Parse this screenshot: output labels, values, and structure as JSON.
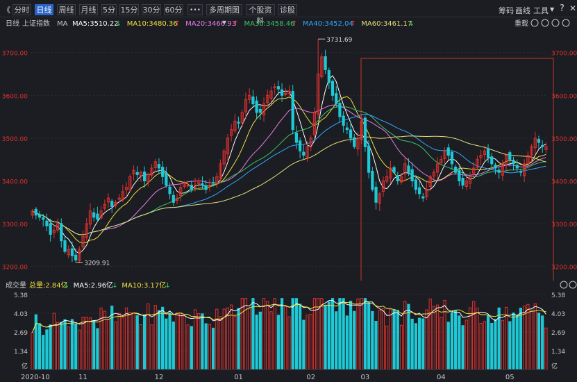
{
  "toolbar": {
    "back_glyph": "《",
    "buttons": [
      "分时",
      "日线",
      "周线",
      "月线",
      "5分",
      "15分",
      "30分",
      "60分",
      "•••",
      "多周期图",
      "个股资料",
      "诊股"
    ],
    "active": "日线",
    "right_items": [
      "筹码",
      "画线",
      "工具"
    ]
  },
  "info_bar": {
    "period": "日线",
    "index_name": "上证指数",
    "ma_label": "MA",
    "ma_items": [
      {
        "label": "MA5:3510.22",
        "color": "#ffffff",
        "arrow": "↓",
        "arrow_color": "#22d35b"
      },
      {
        "label": "MA10:3480.36",
        "color": "#f0e040",
        "arrow": "↑",
        "arrow_color": "#ff3b3b"
      },
      {
        "label": "MA20:3466.93",
        "color": "#e87ce8",
        "arrow": "↑",
        "arrow_color": "#ff3b3b"
      },
      {
        "label": "MA30:3458.46",
        "color": "#3ec46a",
        "arrow": "↑",
        "arrow_color": "#ff3b3b"
      },
      {
        "label": "MA40:3452.04",
        "color": "#33a8ff",
        "arrow": "↑",
        "arrow_color": "#ff3b3b"
      },
      {
        "label": "MA60:3461.17",
        "color": "#e6df7a",
        "arrow": "↓",
        "arrow_color": "#22d35b"
      }
    ],
    "right_label": "重载"
  },
  "volume_bar": {
    "title": "成交量",
    "items": [
      {
        "label": "总量:2.84亿",
        "color": "#f0e040",
        "arrow": "↓",
        "arrow_color": "#22d35b"
      },
      {
        "label": "MA5:2.96亿",
        "color": "#ffffff",
        "arrow": "↓",
        "arrow_color": "#22d35b"
      },
      {
        "label": "MA10:3.17亿",
        "color": "#f0e040",
        "arrow": "↓",
        "arrow_color": "#22d35b"
      }
    ]
  },
  "colors": {
    "up": "#e0312e",
    "down": "#1fc9d6",
    "axis_red": "#e0312e",
    "grid": "#2c2f36"
  },
  "chart_data": {
    "type": "candlestick",
    "price_axis": {
      "ticks": [
        "3200.00",
        "3300.00",
        "3400.00",
        "3500.00",
        "3600.00",
        "3700.00"
      ],
      "range": [
        3180,
        3745
      ]
    },
    "volume_axis": {
      "ticks": [
        "1.34",
        "2.69",
        "4.03",
        "5.38"
      ],
      "range": [
        0,
        5.38
      ],
      "unit": "亿"
    },
    "x_labels": [
      "2020-10",
      "11",
      "12",
      "01",
      "02",
      "03",
      "04",
      "05"
    ],
    "x_label_positions": [
      2,
      14,
      35,
      57,
      77,
      92,
      113,
      132
    ],
    "annotations": [
      {
        "text": "3731.69",
        "index": 79
      },
      {
        "text": "3209.91",
        "index": 12
      }
    ],
    "close": [
      3330,
      3320,
      3315,
      3310,
      3295,
      3275,
      3285,
      3300,
      3260,
      3235,
      3240,
      3225,
      3215,
      3240,
      3270,
      3300,
      3330,
      3315,
      3310,
      3330,
      3345,
      3360,
      3340,
      3350,
      3360,
      3375,
      3385,
      3410,
      3425,
      3415,
      3420,
      3400,
      3415,
      3430,
      3445,
      3430,
      3410,
      3390,
      3370,
      3350,
      3360,
      3385,
      3395,
      3390,
      3380,
      3390,
      3400,
      3390,
      3380,
      3390,
      3395,
      3410,
      3440,
      3470,
      3500,
      3520,
      3540,
      3535,
      3560,
      3590,
      3600,
      3580,
      3560,
      3560,
      3580,
      3600,
      3610,
      3620,
      3615,
      3600,
      3605,
      3610,
      3520,
      3490,
      3470,
      3460,
      3480,
      3500,
      3560,
      3650,
      3690,
      3660,
      3630,
      3600,
      3580,
      3550,
      3530,
      3520,
      3500,
      3480,
      3500,
      3540,
      3480,
      3420,
      3380,
      3350,
      3370,
      3400,
      3410,
      3430,
      3420,
      3400,
      3410,
      3440,
      3420,
      3400,
      3380,
      3370,
      3360,
      3380,
      3410,
      3420,
      3440,
      3450,
      3470,
      3460,
      3440,
      3420,
      3400,
      3390,
      3400,
      3410,
      3430,
      3450,
      3460,
      3470,
      3455,
      3440,
      3430,
      3420,
      3440,
      3460,
      3450,
      3440,
      3430,
      3420,
      3440,
      3460,
      3480,
      3500,
      3490,
      3480,
      3480
    ]
  }
}
